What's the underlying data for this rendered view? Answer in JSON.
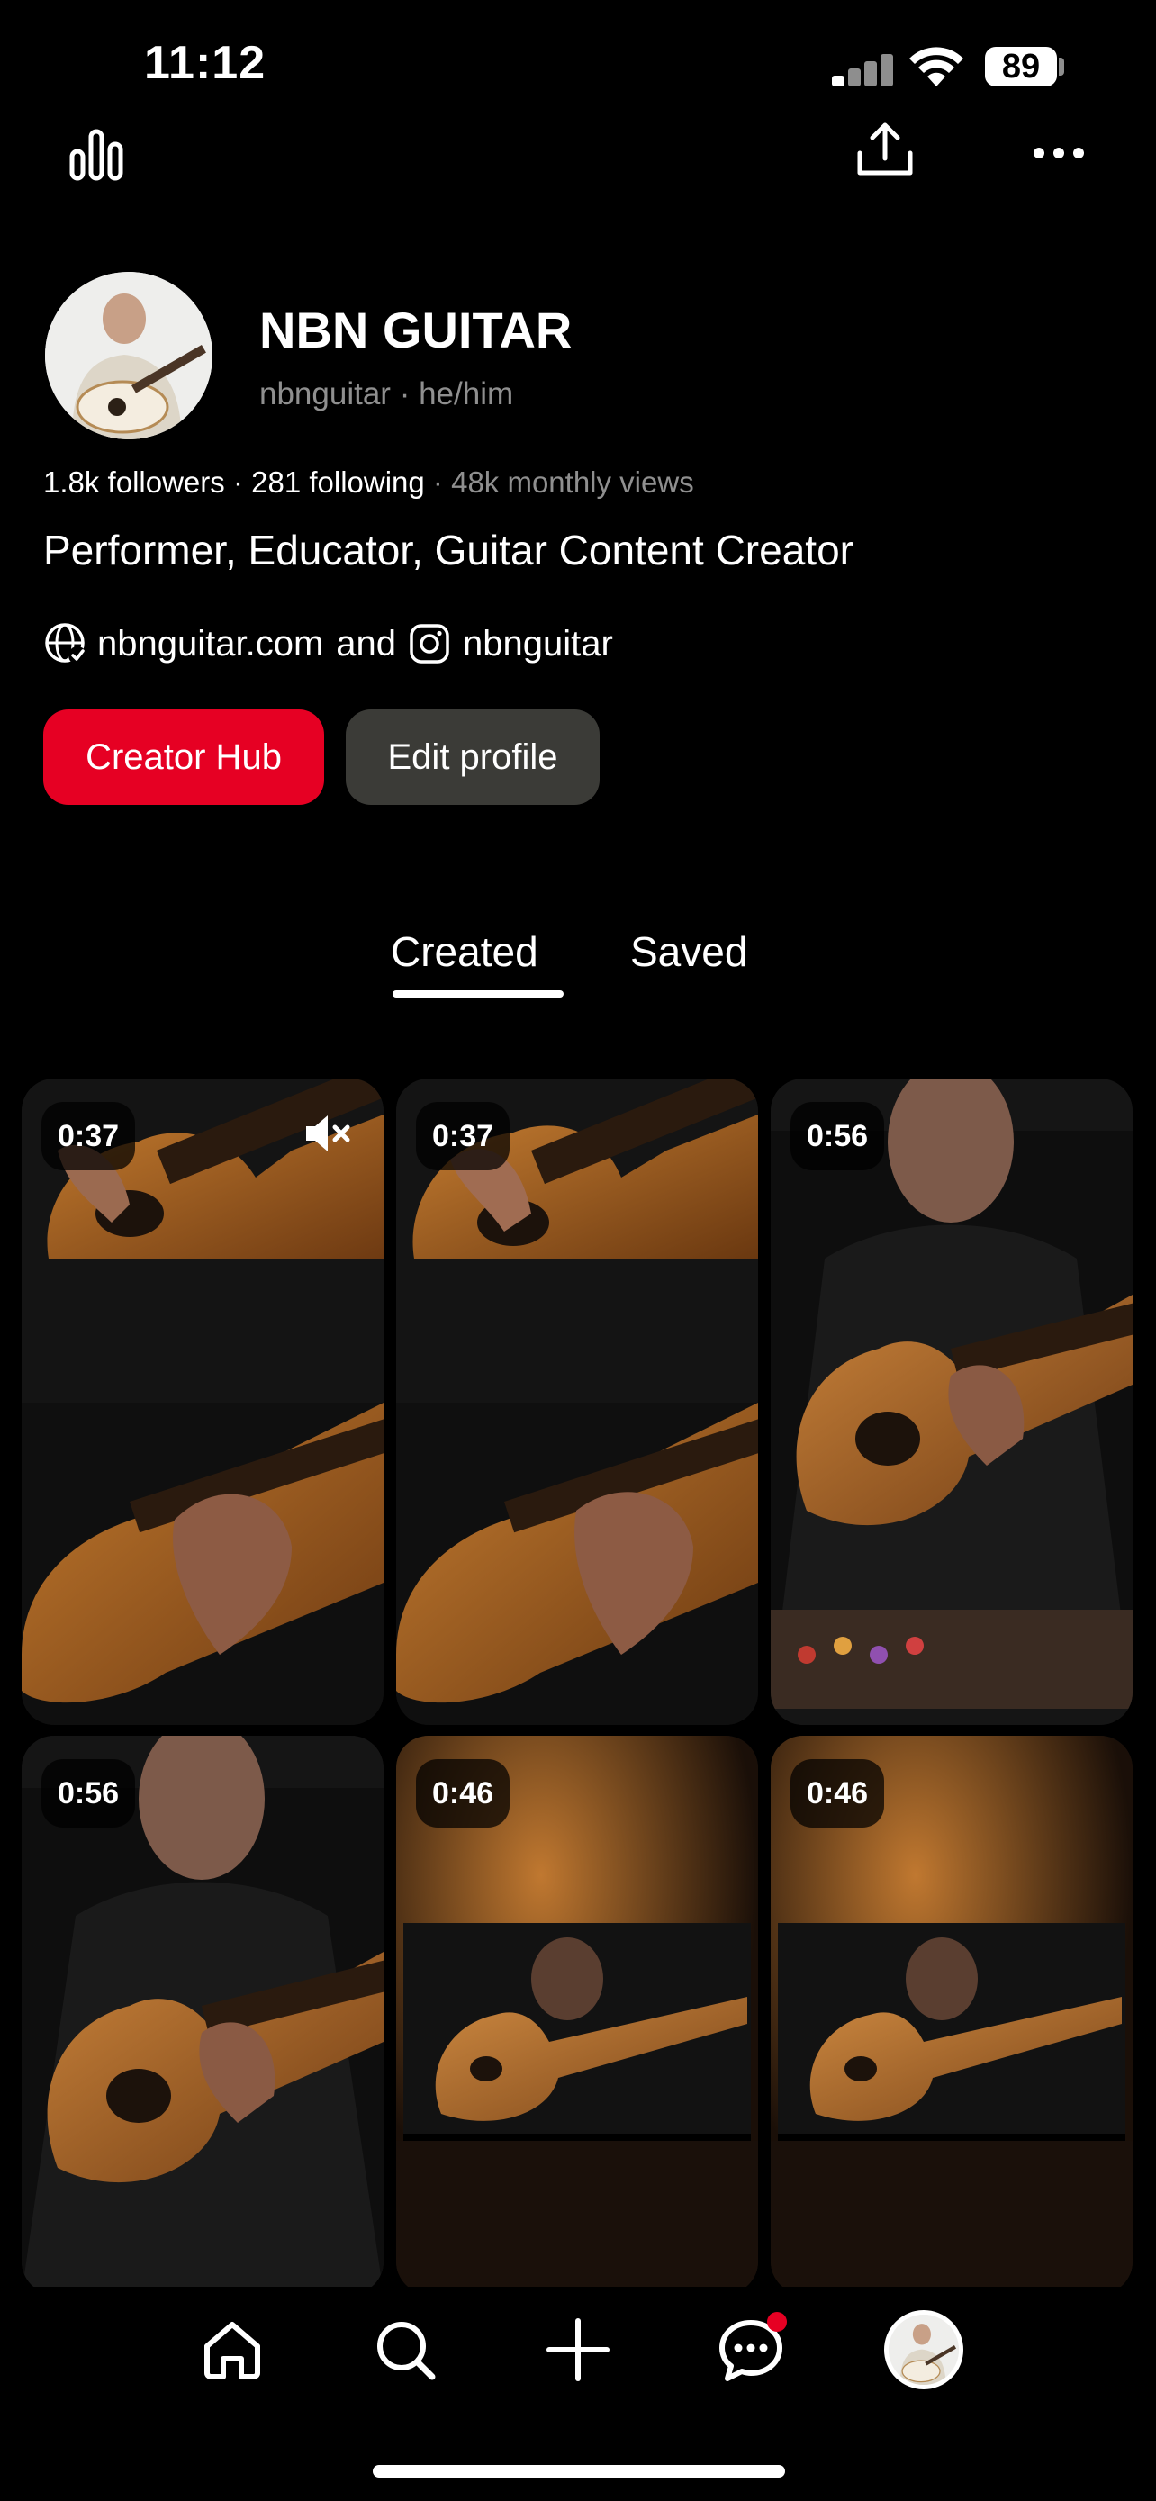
{
  "status_bar": {
    "time": "11:12",
    "battery": "89"
  },
  "profile": {
    "name": "NBN GUITAR",
    "handle": "nbnguitar",
    "pronouns": "he/him",
    "followers": "1.8k followers",
    "following": "281 following",
    "monthly_views": "48k monthly views",
    "bio": "Performer, Educator, Guitar Content Creator",
    "website": "nbnguitar.com",
    "link_joiner": "and",
    "instagram": "nbnguitar"
  },
  "buttons": {
    "creator_hub": "Creator Hub",
    "edit_profile": "Edit profile"
  },
  "tabs": [
    {
      "label": "Created",
      "active": true
    },
    {
      "label": "Saved",
      "active": false
    }
  ],
  "pins": [
    {
      "duration": "0:37",
      "muted": true
    },
    {
      "duration": "0:37"
    },
    {
      "duration": "0:56"
    },
    {
      "duration": "0:56"
    },
    {
      "duration": "0:46"
    },
    {
      "duration": "0:46"
    }
  ],
  "icons": {
    "analytics": "bar-chart-icon",
    "share": "share-icon",
    "more": "more-icon",
    "home": "home-icon",
    "search": "search-icon",
    "create": "plus-icon",
    "messages": "chat-icon",
    "profile": "avatar"
  },
  "colors": {
    "accent": "#e60023",
    "secondary_button": "#3b3b37",
    "muted_text": "#8f8f8f",
    "notification_dot": "#e60023"
  }
}
